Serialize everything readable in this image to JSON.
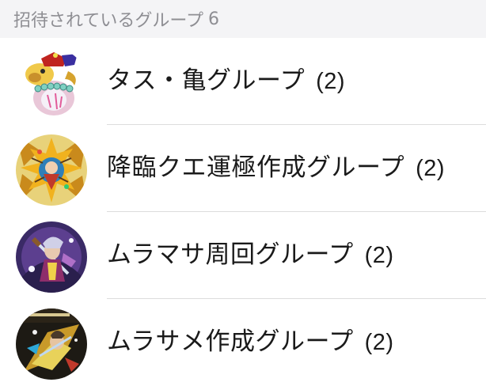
{
  "header": {
    "title": "招待されているグループ",
    "count": "6"
  },
  "groups": [
    {
      "name": "タス・亀グループ",
      "members": "(2)",
      "avatar_icon": "turtle-character-avatar-icon"
    },
    {
      "name": "降臨クエ運極作成グループ",
      "members": "(2)",
      "avatar_icon": "golden-dragon-character-avatar-icon"
    },
    {
      "name": "ムラマサ周回グループ",
      "members": "(2)",
      "avatar_icon": "samurai-character-avatar-icon"
    },
    {
      "name": "ムラサメ作成グループ",
      "members": "(2)",
      "avatar_icon": "warrior-character-avatar-icon"
    }
  ]
}
